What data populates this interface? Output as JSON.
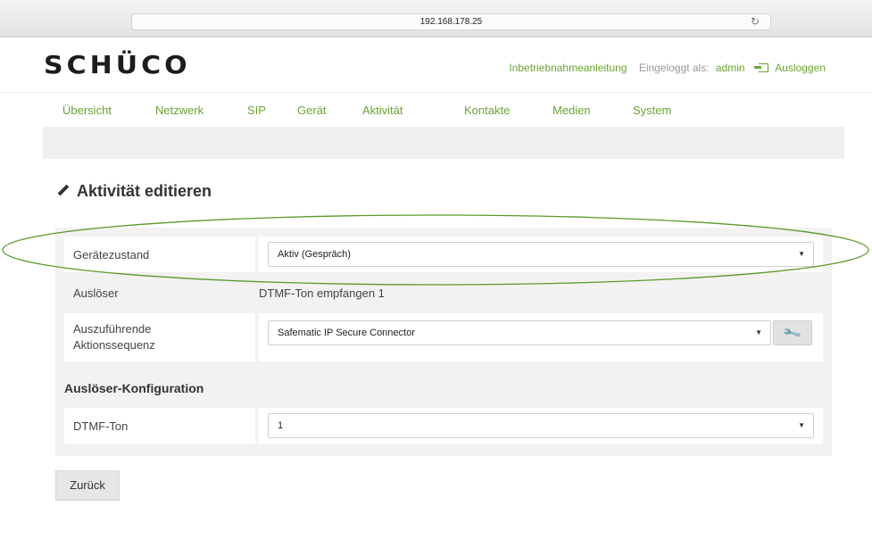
{
  "browser": {
    "url": "192.168.178.25",
    "reload_icon": "reload-icon"
  },
  "header": {
    "logo_text": "SCHÜCO",
    "guide_link": "Inbetriebnahmeanleitung",
    "logged_in_label": "Eingeloggt als:",
    "user": "admin",
    "logout_label": "Ausloggen",
    "accent_color": "#6aa531"
  },
  "nav": {
    "items": [
      "Übersicht",
      "Netzwerk",
      "SIP",
      "Gerät",
      "Aktivität",
      "Kontakte",
      "Medien",
      "System"
    ]
  },
  "page": {
    "title": "Aktivität editieren",
    "title_icon": "pencil-icon"
  },
  "form": {
    "device_state": {
      "label": "Gerätezustand",
      "value": "Aktiv (Gespräch)"
    },
    "trigger": {
      "label": "Auslöser",
      "value": "DTMF-Ton empfangen 1"
    },
    "action_sequence": {
      "label_line1": "Auszuführende",
      "label_line2": "Aktionssequenz",
      "value": "Safematic IP Secure Connector",
      "config_icon": "wrench-icon"
    },
    "trigger_config_heading": "Auslöser-Konfiguration",
    "dtmf": {
      "label": "DTMF-Ton",
      "value": "1"
    }
  },
  "back_button": "Zurück",
  "annotation_color": "#5a9a2a"
}
